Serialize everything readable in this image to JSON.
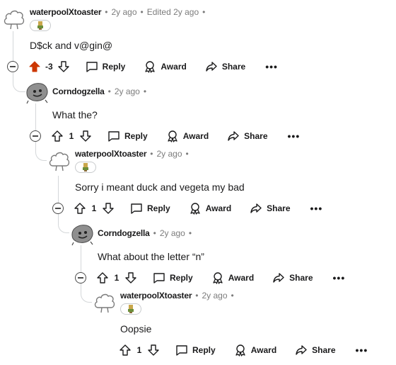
{
  "labels": {
    "reply": "Reply",
    "award": "Award",
    "share": "Share",
    "more": "•••",
    "dot": "•"
  },
  "colors": {
    "upvote_active": "#cc3700",
    "line": "#d4d7d9"
  },
  "comments": [
    {
      "author": "waterpoolXtoaster",
      "time": "2y ago",
      "edited": "Edited 2y ago",
      "body": "D$ck and v@gin@",
      "score": "-3",
      "vote": "upvoted",
      "avatar": "cloud-avatar-icon",
      "flair": "trophy-flair-icon"
    },
    {
      "author": "Corndogzella",
      "time": "2y ago",
      "body": "What the?",
      "score": "1",
      "avatar": "gray-blob-avatar-icon"
    },
    {
      "author": "waterpoolXtoaster",
      "time": "2y ago",
      "body": "Sorry i meant duck and vegeta my bad",
      "score": "1",
      "avatar": "cloud-avatar-icon",
      "flair": "trophy-flair-icon"
    },
    {
      "author": "Corndogzella",
      "time": "2y ago",
      "body": "What about the letter “n”",
      "score": "1",
      "avatar": "gray-blob-avatar-icon"
    },
    {
      "author": "waterpoolXtoaster",
      "time": "2y ago",
      "body": "Oopsie",
      "score": "1",
      "avatar": "cloud-avatar-icon",
      "flair": "trophy-flair-icon"
    }
  ]
}
